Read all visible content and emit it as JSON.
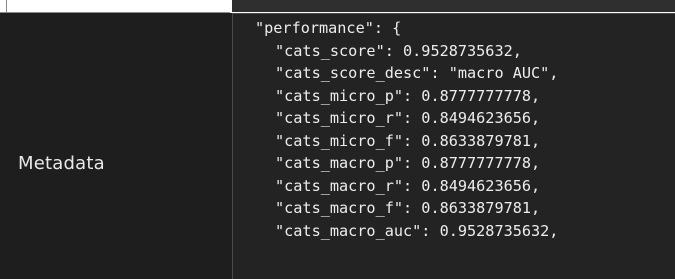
{
  "row": {
    "label": "Metadata"
  },
  "code": {
    "header_line": "\"performance\": {",
    "lines": [
      "\"cats_score\": 0.9528735632,",
      "\"cats_score_desc\": \"macro AUC\",",
      "\"cats_micro_p\": 0.8777777778,",
      "\"cats_micro_r\": 0.8494623656,",
      "\"cats_micro_f\": 0.8633879781,",
      "\"cats_macro_p\": 0.8777777778,",
      "\"cats_macro_r\": 0.8494623656,",
      "\"cats_macro_f\": 0.8633879781,",
      "\"cats_macro_auc\": 0.9528735632,"
    ]
  },
  "colors": {
    "background": "#1e1e1e",
    "text": "#ededed"
  }
}
